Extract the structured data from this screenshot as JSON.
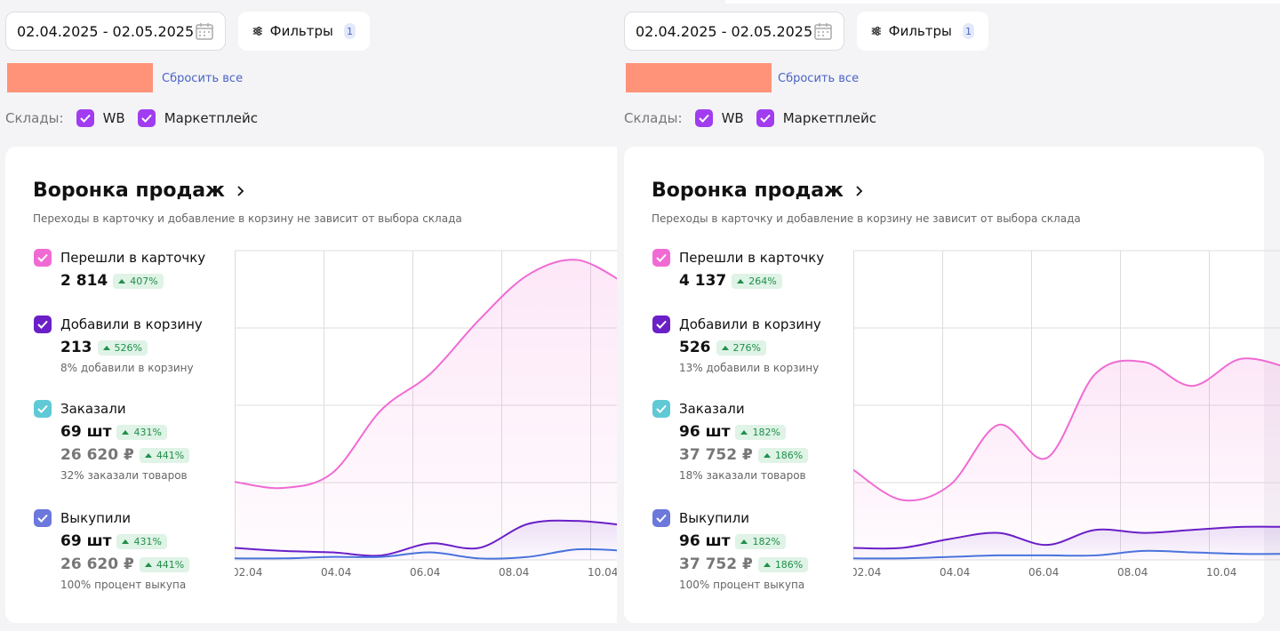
{
  "left": {
    "date_range": "02.04.2025 - 02.05.2025",
    "filters_label": "Фильтры",
    "filters_count": "1",
    "reset_label": "Сбросить все",
    "warehouses_label": "Склады:",
    "warehouses": [
      {
        "label": "WB"
      },
      {
        "label": "Маркетплейс"
      }
    ],
    "card": {
      "title": "Воронка продаж",
      "subtitle": "Переходы в карточку и добавление в корзину не зависит от выбора склада",
      "metrics": {
        "views": {
          "label": "Перешли в карточку",
          "value": "2 814",
          "delta": "407%"
        },
        "cart": {
          "label": "Добавили в корзину",
          "value": "213",
          "delta": "526%",
          "note": "8% добавили в корзину"
        },
        "orders": {
          "label": "Заказали",
          "value": "69 шт",
          "delta": "431%",
          "sum": "26 620 ₽",
          "sum_delta": "441%",
          "note": "32% заказали товаров"
        },
        "buyouts": {
          "label": "Выкупили",
          "value": "69 шт",
          "delta": "431%",
          "sum": "26 620 ₽",
          "sum_delta": "441%",
          "note": "100% процент выкупа"
        }
      }
    },
    "chart_data": {
      "type": "line",
      "x_tick_labels": [
        "02.04",
        "04.04",
        "06.04",
        "08.04",
        "10.04"
      ],
      "series": [
        {
          "key": "views",
          "color": "#f06ad4",
          "values": [
            0.26,
            0.24,
            0.29,
            0.5,
            0.62,
            0.8,
            0.95,
            1.0,
            0.92
          ]
        },
        {
          "key": "cart",
          "color": "#6a1fc7",
          "values": [
            0.04,
            0.03,
            0.025,
            0.015,
            0.055,
            0.04,
            0.12,
            0.13,
            0.115
          ]
        },
        {
          "key": "buyouts",
          "color": "#4a73dd",
          "values": [
            0.005,
            0.005,
            0.01,
            0.01,
            0.025,
            0.005,
            0.01,
            0.035,
            0.03
          ]
        }
      ]
    }
  },
  "right": {
    "date_range": "02.04.2025 - 02.05.2025",
    "filters_label": "Фильтры",
    "filters_count": "1",
    "reset_label": "Сбросить все",
    "warehouses_label": "Склады:",
    "warehouses": [
      {
        "label": "WB"
      },
      {
        "label": "Маркетплейс"
      }
    ],
    "card": {
      "title": "Воронка продаж",
      "subtitle": "Переходы в карточку и добавление в корзину не зависит от выбора склада",
      "metrics": {
        "views": {
          "label": "Перешли в карточку",
          "value": "4 137",
          "delta": "264%"
        },
        "cart": {
          "label": "Добавили в корзину",
          "value": "526",
          "delta": "276%",
          "note": "13% добавили в корзину"
        },
        "orders": {
          "label": "Заказали",
          "value": "96 шт",
          "delta": "182%",
          "sum": "37 752 ₽",
          "sum_delta": "186%",
          "note": "18% заказали товаров"
        },
        "buyouts": {
          "label": "Выкупили",
          "value": "96 шт",
          "delta": "182%",
          "sum": "37 752 ₽",
          "sum_delta": "186%",
          "note": "100% процент выкупа"
        }
      }
    },
    "chart_data": {
      "type": "line",
      "x_tick_labels": [
        "02.04",
        "04.04",
        "06.04",
        "08.04",
        "10.04"
      ],
      "series": [
        {
          "key": "views",
          "color": "#f06ad4",
          "values": [
            0.3,
            0.2,
            0.25,
            0.45,
            0.34,
            0.62,
            0.66,
            0.58,
            0.67,
            0.64
          ]
        },
        {
          "key": "cart",
          "color": "#6a1fc7",
          "values": [
            0.04,
            0.04,
            0.07,
            0.09,
            0.05,
            0.1,
            0.09,
            0.1,
            0.11,
            0.11
          ]
        },
        {
          "key": "buyouts",
          "color": "#4a73dd",
          "values": [
            0.005,
            0.005,
            0.01,
            0.015,
            0.015,
            0.015,
            0.03,
            0.025,
            0.02,
            0.02
          ]
        }
      ]
    }
  },
  "colors": {
    "views_check": "#f06ad4",
    "cart_check": "#6a1fc7",
    "orders_check": "#5fc9d6",
    "buyouts_check": "#6c78dc",
    "warehouse_check": "#a13cf0"
  }
}
